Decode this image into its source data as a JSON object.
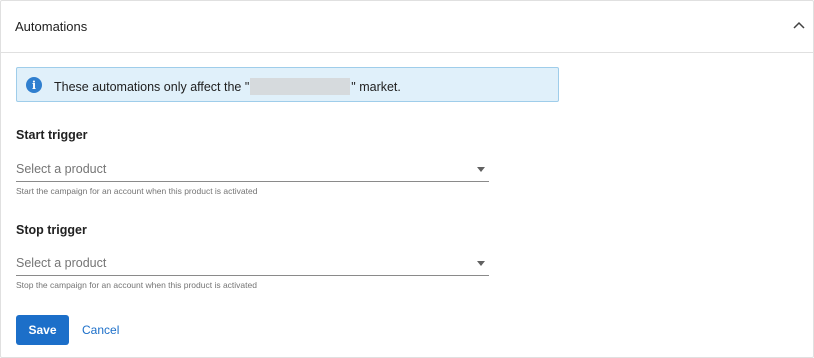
{
  "panel": {
    "title": "Automations",
    "collapse_icon": "chevron-up-icon"
  },
  "banner": {
    "icon": "info-icon",
    "icon_glyph": "i",
    "text_before": "These automations only affect the \"",
    "text_after": "\" market."
  },
  "start_trigger": {
    "label": "Start trigger",
    "placeholder": "Select a product",
    "helper": "Start the campaign for an account when this product is activated"
  },
  "stop_trigger": {
    "label": "Stop trigger",
    "placeholder": "Select a product",
    "helper": "Stop the campaign for an account when this product is activated"
  },
  "actions": {
    "save_label": "Save",
    "cancel_label": "Cancel"
  },
  "colors": {
    "accent": "#1c6fc9",
    "banner_bg": "#e0f0fa",
    "banner_border": "#9fcdea"
  }
}
